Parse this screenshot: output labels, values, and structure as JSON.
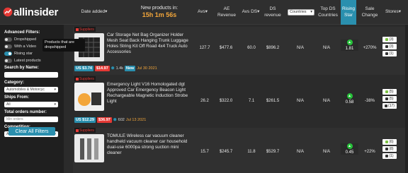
{
  "app": {
    "logo_text": "allinsider"
  },
  "header": {
    "date_added": "Date added",
    "new_products_label": "New products in:",
    "new_products_timer": "15h 1m 56s",
    "avs": "Avs",
    "ae_revenue": "AE Revenue",
    "avs_ds": "Avs DS",
    "ds_revenue": "DS revenue",
    "countries_select": "Countries",
    "top_ds_countries": "Top DS Countries",
    "rising_star": "Rising Star",
    "sale_change": "Sale Change",
    "stores": "Stores"
  },
  "sidebar": {
    "advanced_filters": "Advanced Filters:",
    "toggles": [
      {
        "label": "Dropshipped",
        "on": false
      },
      {
        "label": "With a Video",
        "on": false
      },
      {
        "label": "Rising star",
        "on": true
      },
      {
        "label": "Latest products",
        "on": false
      }
    ],
    "tooltip": "Products that are dropshipped",
    "search_by_name": "Search by Name:",
    "search_placeholder": "",
    "category_label": "Category:",
    "category_value": "Automobiles & Motorcyc",
    "ships_from_label": "Ships From:",
    "ships_from_value": "All",
    "total_orders_label": "Total orders number:",
    "total_orders_placeholder": "Min orders",
    "competition_label": "Competition:",
    "competition_value": "All Stores",
    "clear_button": "Clear All Filters"
  },
  "rows": [
    {
      "badge": "Suppliers",
      "title": "Car Storage Net Bag Organizer Holder Mesh Seat Back Hanging Trunk Luggage Holes String Kit Off Road 4x4 Truck Auto Accessories",
      "price_us": "US $3.74",
      "price_old": "$14.97",
      "orders": "1.4k",
      "new_tag": "New",
      "date": "Jul 30 2021",
      "avs": "127.7",
      "ae_revenue": "$477.6",
      "avs_ds": "60.0",
      "ds_revenue": "$896.2",
      "top_ds": "N/A",
      "top_ds_countries": "N/A",
      "rising": "1.81",
      "sale_change": "+270%",
      "stores": [
        "(3)",
        "(3)",
        "(1)"
      ]
    },
    {
      "badge": "Suppliers",
      "title": "Emergency Light V16 Homologated dgt Approved Car Emergency Beacon Light Rechargeable Magnetic Induction Strobe Light",
      "price_us": "US $12.29",
      "price_old": "$36.97",
      "orders": "602",
      "new_tag": "",
      "date": "Jul 13 2021",
      "avs": "26.2",
      "ae_revenue": "$322.0",
      "avs_ds": "7.1",
      "ds_revenue": "$261.5",
      "top_ds": "N/A",
      "top_ds_countries": "N/A",
      "rising": "0.58",
      "sale_change": "-38%",
      "stores": [
        "(5)",
        "(5)",
        "(17)"
      ]
    },
    {
      "badge": "Suppliers",
      "title": "TOMULE Wireless car vacuum cleaner handheld vacuum cleaner car household dual-use 6000pa strong suction mini cleaner",
      "price_us": "",
      "price_old": "",
      "orders": "",
      "new_tag": "",
      "date": "",
      "avs": "15.7",
      "ae_revenue": "$245.7",
      "avs_ds": "11.8",
      "ds_revenue": "$529.7",
      "top_ds": "N/A",
      "top_ds_countries": "N/A",
      "rising": "0.45",
      "sale_change": "+22%",
      "stores": [
        "(6)",
        "(8)",
        "(1)"
      ]
    }
  ],
  "colors": {
    "accent": "#2a8fae",
    "orange": "#f3a63a",
    "red": "#e53935",
    "green": "#27c13a"
  }
}
